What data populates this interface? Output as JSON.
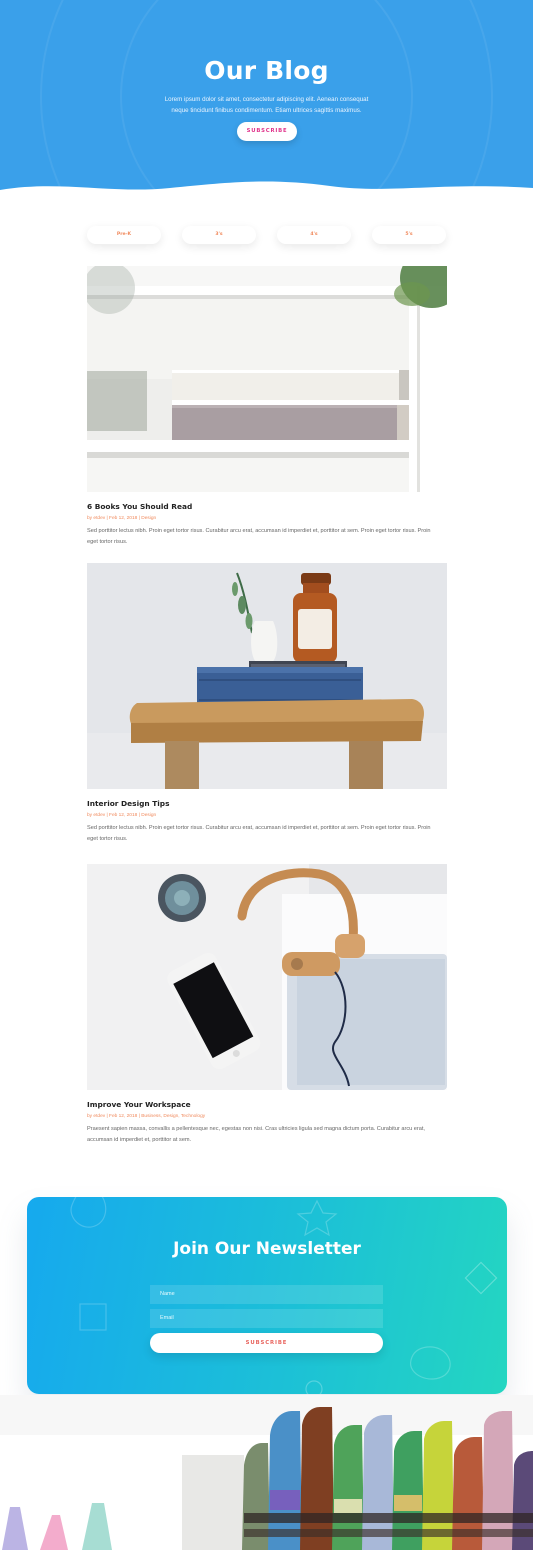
{
  "hero": {
    "title": "Our Blog",
    "subtitle_line1": "Lorem ipsum dolor sit amet, consectetur adipiscing elit. Aenean consequat",
    "subtitle_line2": "neque tincidunt finibus condimentum. Etiam ultrices sagittis maximus.",
    "subscribe_label": "SUBSCRIBE",
    "background_color": "#3aa0ea",
    "accent_color": "#e0338b"
  },
  "filters": [
    "Pre-K",
    "3's",
    "4's",
    "5's"
  ],
  "posts": [
    {
      "title": "6 Books You Should Read",
      "meta": "by etdev | Feb 12, 2018 | Design",
      "excerpt_line1": "Sed porttitor lectus nibh. Proin eget tortor risus. Curabitur arcu erat, accumsan id imperdiet et, porttitor at sem. Proin eget tortor risus. Proin",
      "excerpt_line2": "eget tortor risus."
    },
    {
      "title": "Interior Design Tips",
      "meta": "by etdev | Feb 12, 2018 | Design",
      "excerpt_line1": "Sed porttitor lectus nibh. Proin eget tortor risus. Curabitur arcu erat, accumsan id imperdiet et, porttitor at sem. Proin eget tortor risus. Proin",
      "excerpt_line2": "eget tortor risus."
    },
    {
      "title": "Improve Your Workspace",
      "meta": "by etdev | Feb 12, 2018 | Business, Design, Technology",
      "excerpt_line1": "Praesent sapien massa, convallis a pellentesque nec, egestas non nisi. Cras ultricies ligula sed magna dictum porta. Curabitur arcu erat,",
      "excerpt_line2": "accumsan id imperdiet et, porttitor at sem."
    }
  ],
  "newsletter": {
    "title": "Join Our Newsletter",
    "name_placeholder": "Name",
    "email_placeholder": "Email",
    "subscribe_label": "SUBSCRIBE",
    "gradient_start": "#16a9ee",
    "gradient_end": "#24d6c1"
  }
}
